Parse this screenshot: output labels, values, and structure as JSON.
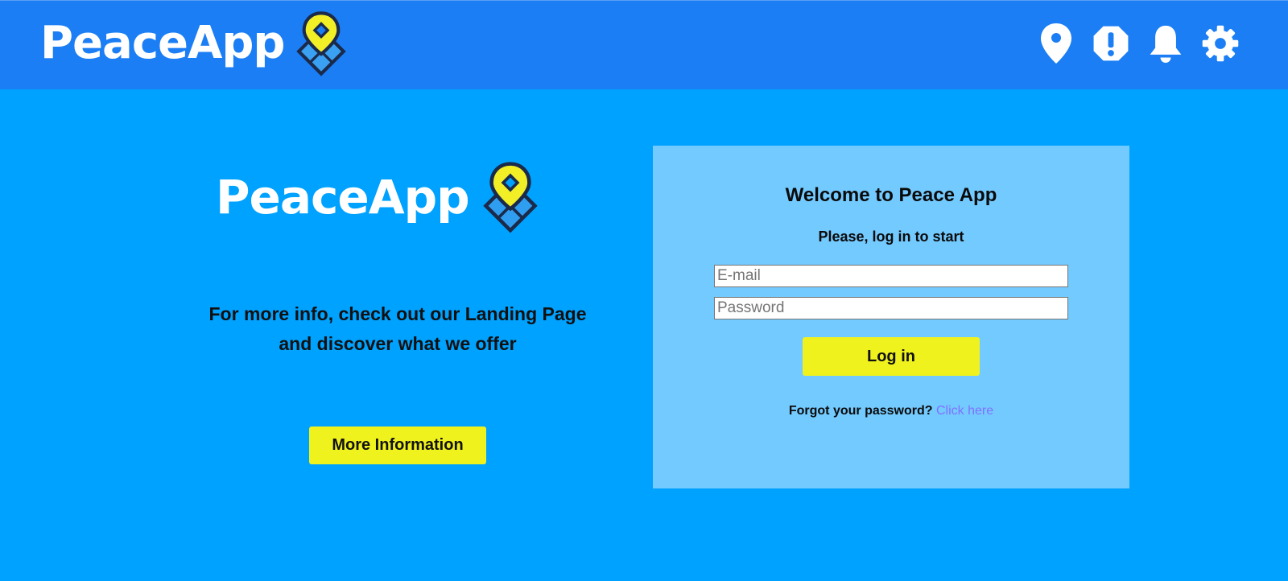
{
  "app": {
    "name": "PeaceApp"
  },
  "header": {
    "logo_text": "PeaceApp",
    "icons": [
      "location-pin-icon",
      "alert-octagon-icon",
      "bell-icon",
      "gear-icon"
    ]
  },
  "hero": {
    "logo_text": "PeaceApp",
    "info_text": "For more info, check out our Landing Page and discover what we offer",
    "more_button_label": "More Information"
  },
  "login": {
    "title": "Welcome to Peace App",
    "subtitle": "Please, log in to start",
    "email_placeholder": "E-mail",
    "email_value": "",
    "password_placeholder": "Password",
    "password_value": "",
    "login_button_label": "Log in",
    "forgot_text": "Forgot your password?",
    "forgot_link_label": "Click here"
  },
  "colors": {
    "background": "#00a2ff",
    "header": "#1b7ef4",
    "card": "#73caff",
    "button": "#f0f21e",
    "link": "#8170ff",
    "logo_pin": "#f2ef27",
    "logo_outline": "#1b2a4a"
  }
}
